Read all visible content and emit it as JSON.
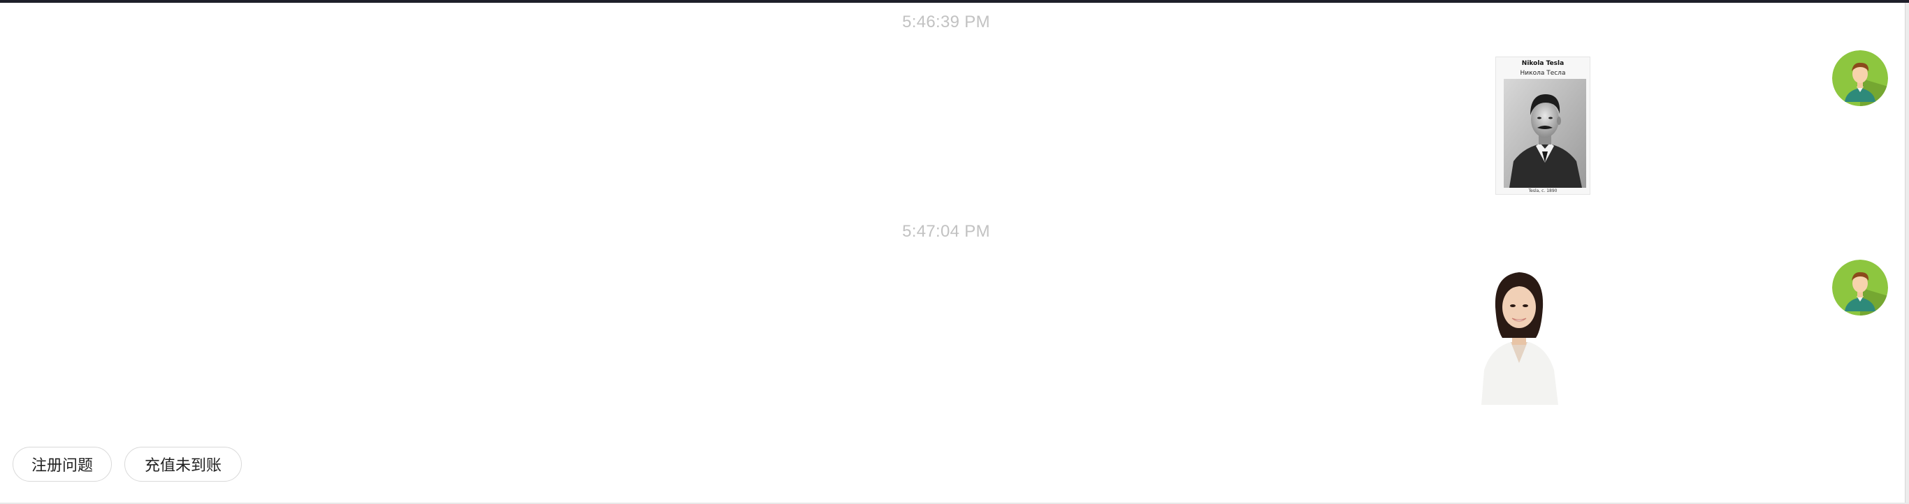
{
  "messages": [
    {
      "timestamp": "5:46:39 PM",
      "image": {
        "title": "Nikola Tesla",
        "subtitle": "Никола Тесла",
        "caption": "Tesla, c. 1890"
      },
      "avatar_icon": "user-avatar-icon"
    },
    {
      "timestamp": "5:47:04 PM",
      "image": {
        "kind": "portrait-photo"
      },
      "avatar_icon": "user-avatar-icon"
    }
  ],
  "quick_replies": [
    {
      "label": "注册问题"
    },
    {
      "label": "充值未到账"
    }
  ],
  "colors": {
    "avatar_bg": "#8dc63f",
    "avatar_shadow": "#5e8f2b",
    "timestamp": "#c2c2c2",
    "border_top": "#1e1f2a"
  }
}
